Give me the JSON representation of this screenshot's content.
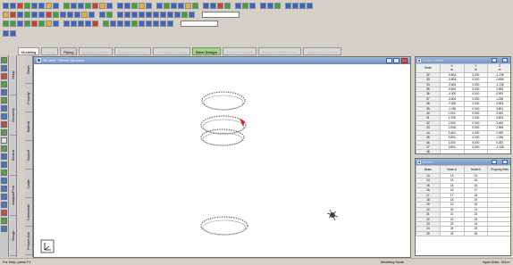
{
  "view": {
    "title": "3D view - Whole Structure"
  },
  "ribbon_tabs": [
    {
      "label": "Modeling",
      "state": "active"
    },
    {
      "label": "Piping",
      "state": "dim"
    },
    {
      "label": "Piping",
      "state": "normal"
    },
    {
      "label": "Building Planner",
      "state": "dim"
    },
    {
      "label": "Connection Design",
      "state": "dim"
    },
    {
      "label": "Foundation Design",
      "state": "dim"
    },
    {
      "label": "Steel Design",
      "state": "steel"
    },
    {
      "label": "Concrete Design",
      "state": "dim"
    },
    {
      "label": "Advanced Slab Design",
      "state": "dim"
    },
    {
      "label": "Advanced Concrete",
      "state": "dim"
    }
  ],
  "side_tabs_outer": [
    "Setup",
    "Geometry",
    "General",
    "Analysis/Print",
    "Design"
  ],
  "side_tabs_inner": [
    "Beam",
    "Property",
    "Material",
    "Support",
    "Loads",
    "Commands",
    "Prepare Ana"
  ],
  "nodes_table": {
    "title": "Nodes - Whole",
    "columns": [
      "Node",
      "X\nm",
      "Y\nm",
      "Z\nm"
    ],
    "rows": [
      [
        "32",
        "-3.804",
        "0.000",
        "-1.236"
      ],
      [
        "33",
        "-3.804",
        "0.000",
        "-0.866"
      ],
      [
        "34",
        "-3.804",
        "0.000",
        "-1.236"
      ],
      [
        "35",
        "-3.804",
        "0.000",
        "2.908"
      ],
      [
        "36",
        "-4.000",
        "0.000",
        "0.000"
      ],
      [
        "37",
        "-3.804",
        "0.000",
        "1.236"
      ],
      [
        "38",
        "-2.000",
        "0.000",
        "3.464"
      ],
      [
        "39",
        "-1.236",
        "0.000",
        "3.804"
      ],
      [
        "40",
        "0.000",
        "0.000",
        "4.000"
      ],
      [
        "41",
        "1.236",
        "0.000",
        "3.804"
      ],
      [
        "42",
        "2.000",
        "0.000",
        "3.464"
      ],
      [
        "43",
        "2.908",
        "0.000",
        "2.908"
      ],
      [
        "44",
        "3.464",
        "0.000",
        "2.000"
      ],
      [
        "45",
        "3.804",
        "0.000",
        "1.236"
      ],
      [
        "46",
        "4.000",
        "0.000",
        "0.000"
      ],
      [
        "47",
        "3.804",
        "0.000",
        "-1.236"
      ],
      [
        "48",
        "",
        "",
        ""
      ]
    ]
  },
  "beams_table": {
    "title": "Beams",
    "columns": [
      "Beam",
      "Node A",
      "Node B",
      "Property Refs"
    ],
    "rows": [
      [
        "13",
        "13",
        "14",
        ""
      ],
      [
        "14",
        "14",
        "15",
        ""
      ],
      [
        "15",
        "15",
        "16",
        ""
      ],
      [
        "16",
        "16",
        "17",
        ""
      ],
      [
        "17",
        "17",
        "18",
        ""
      ],
      [
        "18",
        "18",
        "19",
        ""
      ],
      [
        "19",
        "19",
        "20",
        ""
      ],
      [
        "20",
        "20",
        "21",
        ""
      ],
      [
        "21",
        "21",
        "22",
        ""
      ],
      [
        "22",
        "22",
        "23",
        ""
      ],
      [
        "23",
        "23",
        "24",
        ""
      ],
      [
        "24",
        "24",
        "25",
        ""
      ],
      [
        "25",
        "25",
        "26",
        ""
      ]
    ]
  },
  "status": {
    "help": "For Help, press F1",
    "mode": "Modeling Mode",
    "units": "Input Units : kN-m"
  },
  "colors": {
    "selected_member": "#cc2a2a",
    "steel_tab": "#a9d18e",
    "title_bar": "#7596c4"
  }
}
